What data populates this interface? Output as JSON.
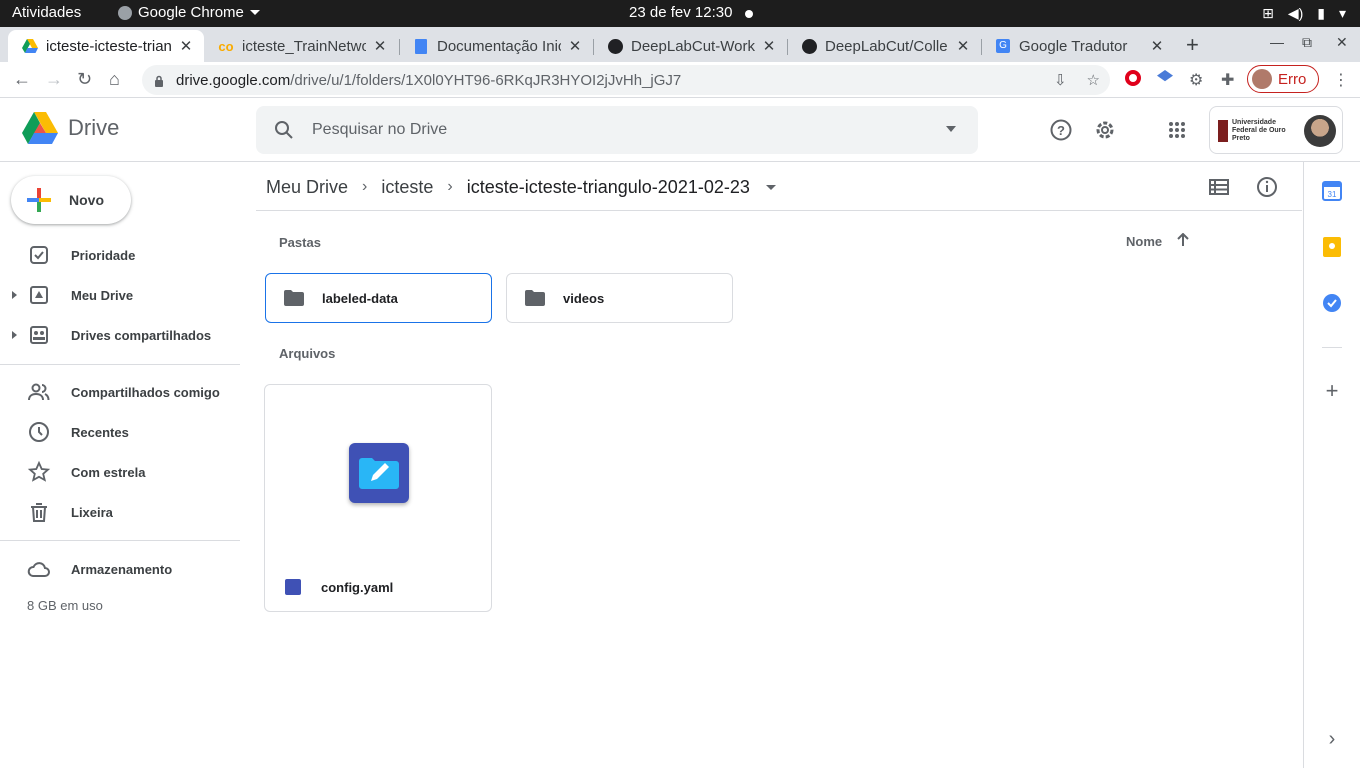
{
  "system": {
    "activities": "Atividades",
    "app_name": "Google Chrome",
    "clock": "23 de fev  12:30"
  },
  "browser": {
    "tabs": [
      {
        "title": "icteste-icteste-trian",
        "icon": "drive-icon",
        "active": true
      },
      {
        "title": "icteste_TrainNetwo",
        "icon": "colab-icon",
        "active": false
      },
      {
        "title": "Documentação Inic",
        "icon": "docs-icon",
        "active": false
      },
      {
        "title": "DeepLabCut-Work",
        "icon": "github-icon",
        "active": false
      },
      {
        "title": "DeepLabCut/Colle",
        "icon": "github-icon",
        "active": false
      },
      {
        "title": "Google Tradutor",
        "icon": "translate-icon",
        "active": false
      }
    ],
    "url_host": "drive.google.com",
    "url_path": "/drive/u/1/folders/1X0l0YHT96-6RKqJR3HYOI2jJvHh_jGJ7",
    "profile_status": "Erro"
  },
  "drive": {
    "logo_text": "Drive",
    "search_placeholder": "Pesquisar no Drive",
    "org_name": "Universidade Federal de Ouro Preto",
    "new_button": "Novo",
    "nav": [
      {
        "label": "Prioridade",
        "icon": "check-circle-icon"
      },
      {
        "label": "Meu Drive",
        "icon": "my-drive-icon"
      },
      {
        "label": "Drives compartilhados",
        "icon": "shared-drives-icon"
      },
      {
        "label": "Compartilhados comigo",
        "icon": "people-icon"
      },
      {
        "label": "Recentes",
        "icon": "clock-icon"
      },
      {
        "label": "Com estrela",
        "icon": "star-icon"
      },
      {
        "label": "Lixeira",
        "icon": "trash-icon"
      },
      {
        "label": "Armazenamento",
        "icon": "cloud-icon"
      }
    ],
    "storage_used": "8 GB em uso",
    "breadcrumb": [
      "Meu Drive",
      "icteste",
      "icteste-icteste-triangulo-2021-02-23"
    ],
    "sections": {
      "folders": "Pastas",
      "files": "Arquivos"
    },
    "sort_label": "Nome",
    "folders": [
      "labeled-data",
      "videos"
    ],
    "files": [
      {
        "name": "config.yaml"
      }
    ],
    "colors": {
      "accent": "#1a73e8",
      "file_icon": "#3f51b5",
      "error": "#c5221f"
    }
  }
}
